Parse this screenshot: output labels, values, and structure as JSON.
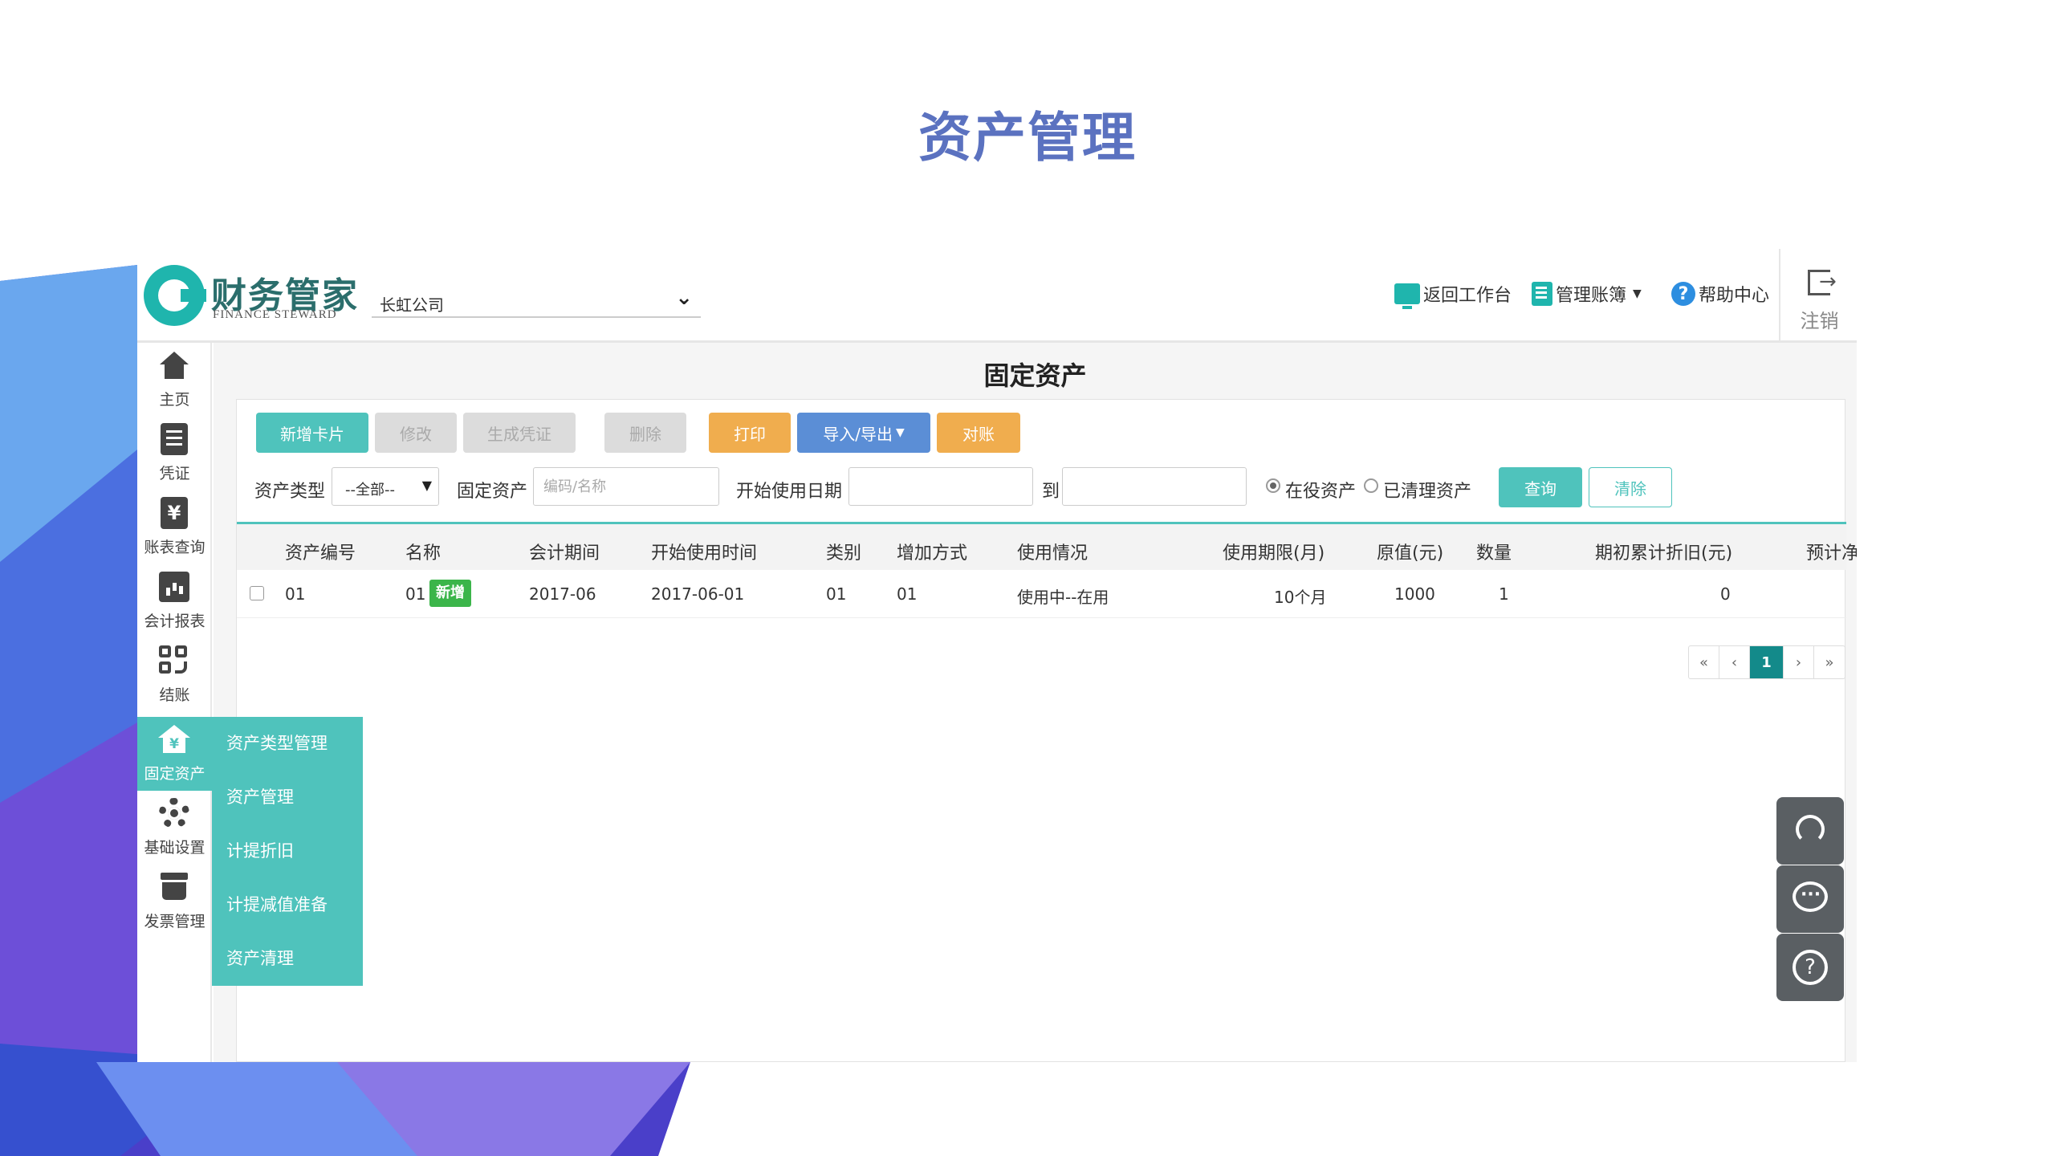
{
  "slide": {
    "title": "资产管理"
  },
  "header": {
    "logo_text": "财务管家",
    "logo_sub": "FINANCE STEWARD",
    "company": "长虹公司",
    "links": {
      "workbench": "返回工作台",
      "manage_books": "管理账簿",
      "help": "帮助中心",
      "logout": "注销"
    }
  },
  "sidebar": {
    "items": [
      {
        "label": "主页",
        "icon": "home-icon"
      },
      {
        "label": "凭证",
        "icon": "voucher-icon"
      },
      {
        "label": "账表查询",
        "icon": "yen-icon"
      },
      {
        "label": "会计报表",
        "icon": "bar-chart-icon"
      },
      {
        "label": "结账",
        "icon": "close-books-icon"
      },
      {
        "label": "固定资产",
        "icon": "fixed-asset-icon",
        "active": true
      },
      {
        "label": "基础设置",
        "icon": "gear-icon"
      },
      {
        "label": "发票管理",
        "icon": "invoice-box-icon"
      }
    ],
    "submenu": [
      "资产类型管理",
      "资产管理",
      "计提折旧",
      "计提减值准备",
      "资产清理"
    ]
  },
  "page": {
    "title": "固定资产"
  },
  "toolbar": {
    "add_card": "新增卡片",
    "edit": "修改",
    "gen_voucher": "生成凭证",
    "delete": "删除",
    "print": "打印",
    "import_export": "导入/导出",
    "reconcile": "对账"
  },
  "filters": {
    "asset_type_label": "资产类型",
    "asset_type_value": "--全部--",
    "fixed_asset_label": "固定资产",
    "fixed_asset_placeholder": "编码/名称",
    "start_date_label": "开始使用日期",
    "to_label": "到",
    "radio_active": "在役资产",
    "radio_cleared": "已清理资产",
    "query": "查询",
    "clear": "清除"
  },
  "table": {
    "headers": [
      "资产编号",
      "名称",
      "会计期间",
      "开始使用时间",
      "类别",
      "增加方式",
      "使用情况",
      "使用期限(月)",
      "原值(元)",
      "数量",
      "期初累计折旧(元)",
      "预计净"
    ],
    "rows": [
      {
        "code": "01",
        "name": "01",
        "badge": "新增",
        "period": "2017-06",
        "start_date": "2017-06-01",
        "category": "01",
        "add_method": "01",
        "usage": "使用中--在用",
        "term": "10个月",
        "original_value": "1000",
        "quantity": "1",
        "accum_dep": "0"
      }
    ]
  },
  "pagination": {
    "first": "«",
    "prev": "‹",
    "current": "1",
    "next": "›",
    "last": "»"
  },
  "colors": {
    "accent": "#4fc3bc",
    "title": "#5b72c0",
    "orange": "#f0ad4e",
    "blue": "#5b8ed6",
    "badge": "#3bb54a"
  }
}
